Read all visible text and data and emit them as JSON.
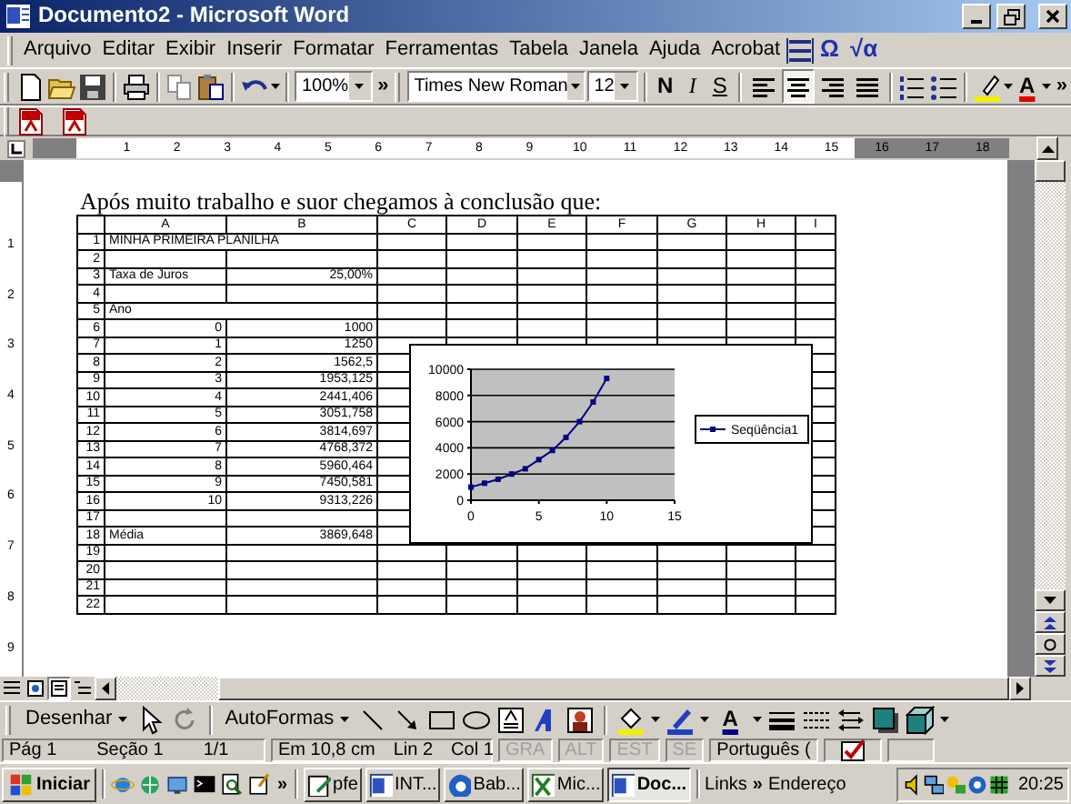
{
  "window": {
    "title": "Documento2 - Microsoft Word"
  },
  "menu": [
    "Arquivo",
    "Editar",
    "Exibir",
    "Inserir",
    "Formatar",
    "Ferramentas",
    "Tabela",
    "Janela",
    "Ajuda",
    "Acrobat"
  ],
  "menu_glyphs": [
    "Ω",
    "√α"
  ],
  "toolbar": {
    "zoom": "100%",
    "more": "»",
    "font": "Times New Roman",
    "size": "12",
    "style_buttons": [
      "N",
      "I",
      "S"
    ],
    "alignment": [
      {
        "selected": false
      },
      {
        "selected": true
      },
      {
        "selected": false
      },
      {
        "selected": false
      }
    ],
    "font_color": "A",
    "more_end": "»"
  },
  "ruler": {
    "numbers": [
      "1",
      "2",
      "3",
      "4",
      "5",
      "6",
      "7",
      "8",
      "9",
      "10",
      "11",
      "12",
      "13",
      "14",
      "15",
      "16",
      "17",
      "18"
    ]
  },
  "vertical_ruler": {
    "numbers": [
      "1",
      "2",
      "3",
      "4",
      "5",
      "6",
      "7",
      "8",
      "9"
    ]
  },
  "document": {
    "paragraph": "Após muito trabalho e suor chegamos à conclusão que:",
    "spreadsheet": {
      "columns": [
        "A",
        "B",
        "C",
        "D",
        "E",
        "F",
        "G",
        "H",
        "I"
      ],
      "rows": [
        {
          "number": "1",
          "kind": "label",
          "a": "MINHA PRIMEIRA PLANILHA"
        },
        {
          "number": "2"
        },
        {
          "number": "3",
          "kind": "label",
          "a": "Taxa de Juros",
          "b": "25,00%"
        },
        {
          "number": "4"
        },
        {
          "number": "5",
          "kind": "label",
          "a": "Ano"
        },
        {
          "number": "6",
          "kind": "value",
          "a": "0",
          "b": "1000"
        },
        {
          "number": "7",
          "kind": "value",
          "a": "1",
          "b": "1250"
        },
        {
          "number": "8",
          "kind": "value",
          "a": "2",
          "b": "1562,5"
        },
        {
          "number": "9",
          "kind": "value",
          "a": "3",
          "b": "1953,125"
        },
        {
          "number": "10",
          "kind": "value",
          "a": "4",
          "b": "2441,406"
        },
        {
          "number": "11",
          "kind": "value",
          "a": "5",
          "b": "3051,758"
        },
        {
          "number": "12",
          "kind": "value",
          "a": "6",
          "b": "3814,697"
        },
        {
          "number": "13",
          "kind": "value",
          "a": "7",
          "b": "4768,372"
        },
        {
          "number": "14",
          "kind": "value",
          "a": "8",
          "b": "5960,464"
        },
        {
          "number": "15",
          "kind": "value",
          "a": "9",
          "b": "7450,581"
        },
        {
          "number": "16",
          "kind": "value",
          "a": "10",
          "b": "9313,226"
        },
        {
          "number": "17"
        },
        {
          "number": "18",
          "kind": "label",
          "a": "Média",
          "b": "3869,648"
        },
        {
          "number": "19"
        },
        {
          "number": "20"
        },
        {
          "number": "21"
        },
        {
          "number": "22"
        }
      ]
    },
    "chart_data": {
      "type": "line",
      "x": [
        0,
        1,
        2,
        3,
        4,
        5,
        6,
        7,
        8,
        9,
        10
      ],
      "series": [
        {
          "name": "Seqüência1",
          "color": "#000080",
          "marker": "square",
          "values": [
            1000,
            1300,
            1600,
            2000,
            2400,
            3100,
            3800,
            4800,
            6000,
            7500,
            9300
          ]
        }
      ],
      "grid": true,
      "xlim": [
        0,
        15
      ],
      "ylim": [
        0,
        10000
      ],
      "xticks": [
        0,
        5,
        10,
        15
      ],
      "yticks": [
        0,
        2000,
        4000,
        6000,
        8000,
        10000
      ]
    }
  },
  "view_buttons": [
    {
      "selected": false
    },
    {
      "selected": false
    },
    {
      "selected": true
    },
    {
      "selected": false
    }
  ],
  "drawing_toolbar": {
    "draw": "Desenhar",
    "autoshapes": "AutoFormas",
    "font_color": "A"
  },
  "status_bar": {
    "page": "Pág 1",
    "section": "Seção 1",
    "pages": "1/1",
    "position": "Em 10,8 cm",
    "line": "Lin 2",
    "column": "Col 1",
    "modes": [
      {
        "label": "GRA",
        "disabled": true
      },
      {
        "label": "ALT",
        "disabled": true
      },
      {
        "label": "EST",
        "disabled": true
      },
      {
        "label": "SE",
        "disabled": true
      }
    ],
    "language": "Português ("
  },
  "taskbar": {
    "start": "Iniciar",
    "more": "»",
    "tasks": [
      {
        "label": "pfe",
        "selected": false
      },
      {
        "label": "INT...",
        "selected": false
      },
      {
        "label": "Bab...",
        "selected": false
      },
      {
        "label": "Mic...",
        "selected": false
      },
      {
        "label": "Doc...",
        "selected": true
      }
    ],
    "links": "Links",
    "links_more": "»",
    "address": "Endereço",
    "clock": "20:25"
  }
}
